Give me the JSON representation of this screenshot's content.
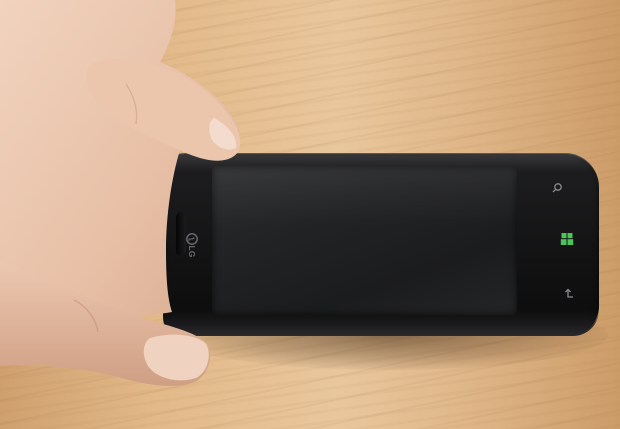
{
  "scene": {
    "subject": "smartphone",
    "brand_text": "LG"
  },
  "colors": {
    "wood_light": "#e9c79d",
    "wood_dark": "#cc9c68",
    "phone_body": "#121213",
    "screen_off": "#222325",
    "skin": "#e8c4ad",
    "windows_key": "#4cc45a"
  },
  "icons": {
    "search": "search-icon",
    "start": "windows-start-icon",
    "back": "back-arrow-icon",
    "logo": "lg-logo-icon"
  }
}
